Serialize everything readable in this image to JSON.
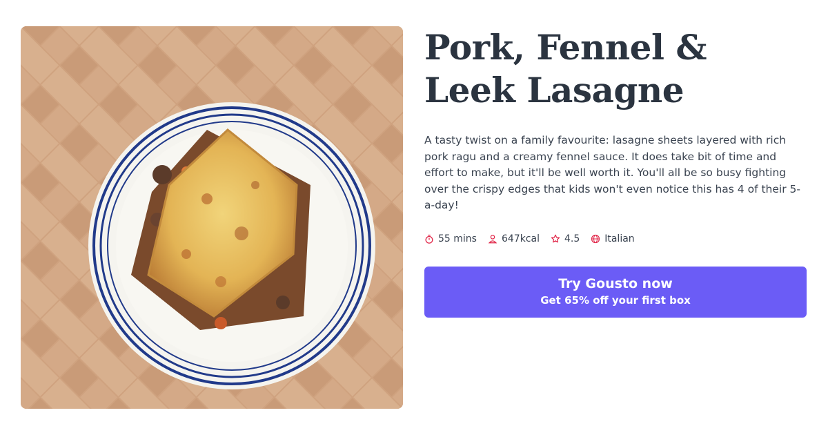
{
  "recipe": {
    "title": "Pork, Fennel & Leek Lasagne",
    "description": "A tasty twist on a family favourite: lasagne sheets layered with rich pork ragu and a creamy fennel sauce. It does take bit of time and effort to make, but it'll be well worth it. You'll all be so busy fighting over the crispy edges that kids won't even notice this has 4 of their 5-a-day!",
    "image_subject": "lasagne on blue-striped plate over herringbone tiles"
  },
  "meta": {
    "time": "55 mins",
    "calories": "647kcal",
    "rating": "4.5",
    "cuisine": "Italian",
    "icons": [
      "timer-icon",
      "person-icon",
      "star-icon",
      "globe-icon"
    ]
  },
  "cta": {
    "main_label": "Try Gousto now",
    "sub_label": "Get 65% off your first box"
  },
  "colors": {
    "accent": "#6b5cf6",
    "icon": "#e1284a",
    "text": "#2b3440"
  }
}
